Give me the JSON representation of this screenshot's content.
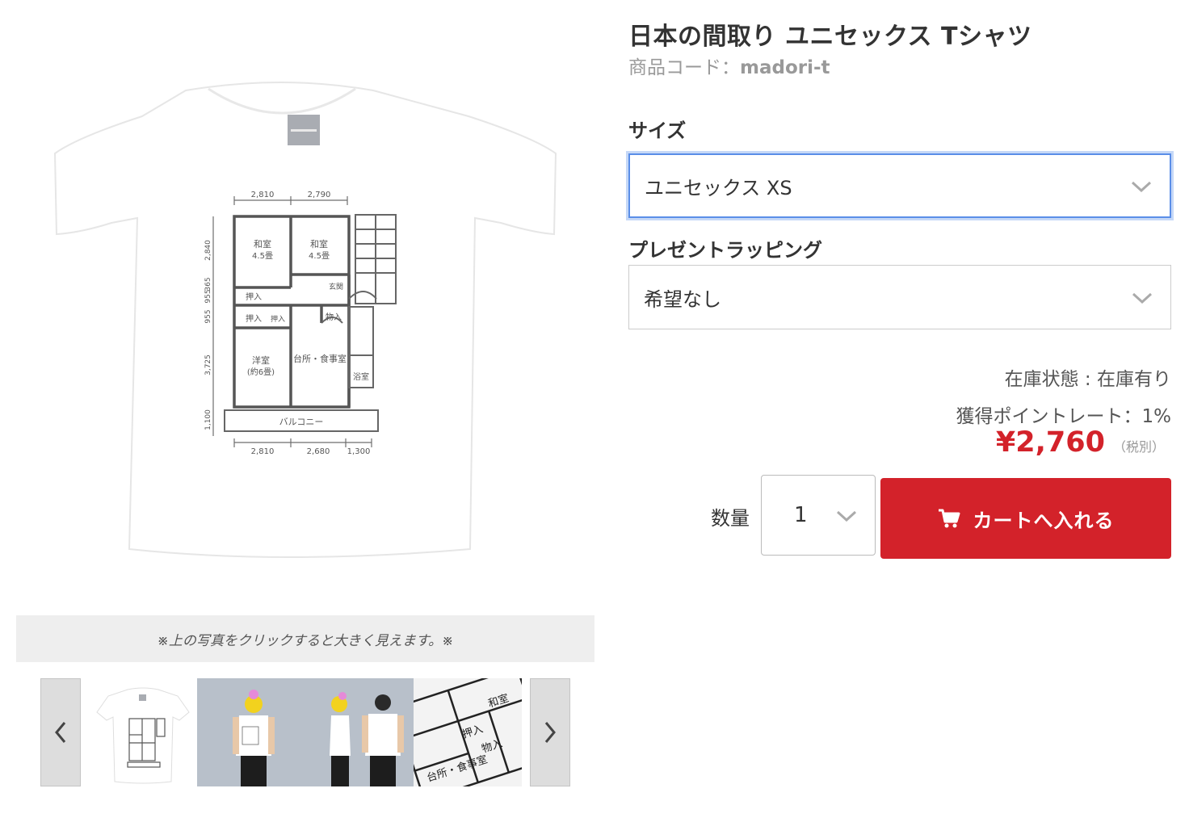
{
  "product": {
    "title": "日本の間取り ユニセックス Tシャツ",
    "code_label": "商品コード：",
    "code_value": "madori-t"
  },
  "image": {
    "floorplan_labels": {
      "washitsu": "和室",
      "size_45": "4.5畳",
      "oshiire": "押入",
      "genkan": "玄関",
      "monoire": "物入",
      "yoshitsu": "洋室",
      "yoshitsu_size": "(約6畳)",
      "kitchen": "台所・食事室",
      "yokushitsu": "浴室",
      "balcony": "バルコニー",
      "dim_top_1": "2,810",
      "dim_top_2": "2,790",
      "dim_bottom_1": "2,810",
      "dim_bottom_2": "2,680",
      "dim_bottom_3": "1,300",
      "dim_left_1": "2,840",
      "dim_left_2": "955",
      "dim_left_3": "365",
      "dim_left_4": "955",
      "dim_left_5": "3,725",
      "dim_left_6": "1,100"
    },
    "caption": "※上の写真をクリックすると大きく見えます。※",
    "thumb_labels": {
      "kitchen": "台所・食事室",
      "monoire": "物入",
      "washitsu": "和室",
      "oshiire": "押入"
    }
  },
  "options": {
    "size_label": "サイズ",
    "size_value": "ユニセックス XS",
    "wrap_label": "プレゼントラッピング",
    "wrap_value": "希望なし"
  },
  "info": {
    "stock": "在庫状態 : 在庫有り",
    "points": "獲得ポイントレート：1%",
    "price": "¥2,760",
    "tax": "（税別）"
  },
  "cart": {
    "qty_label": "数量",
    "qty_value": "1",
    "button_label": "カートへ入れる"
  },
  "colors": {
    "accent_red": "#d3222a",
    "focus_blue": "#5a8ee8",
    "caption_bg": "#eeeeee"
  }
}
